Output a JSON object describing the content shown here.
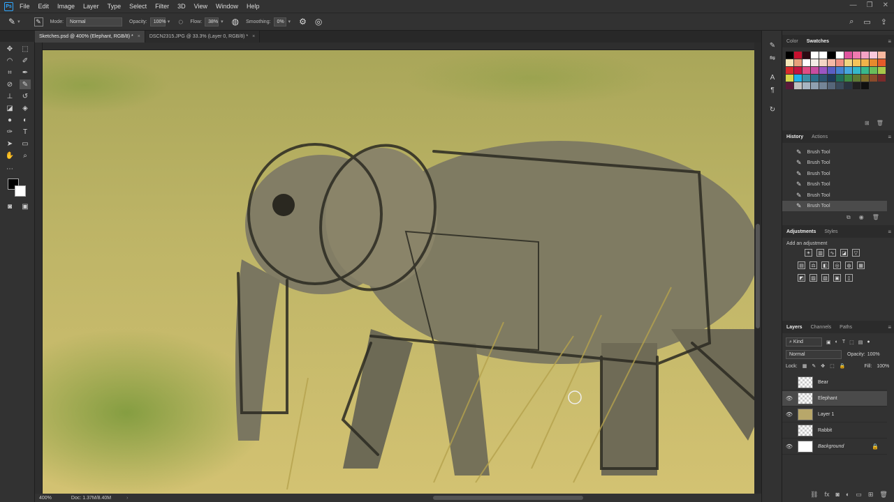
{
  "app": {
    "logo": "Ps"
  },
  "menu": [
    "File",
    "Edit",
    "Image",
    "Layer",
    "Type",
    "Select",
    "Filter",
    "3D",
    "View",
    "Window",
    "Help"
  ],
  "window_controls": [
    "—",
    "❐",
    "✕"
  ],
  "options": {
    "mode_label": "Mode:",
    "mode_value": "Normal",
    "opacity_label": "Opacity:",
    "opacity_value": "100%",
    "flow_label": "Flow:",
    "flow_value": "38%",
    "smoothing_label": "Smoothing:",
    "smoothing_value": "0%"
  },
  "tabs": [
    {
      "label": "Sketches.psd @ 400% (Elephant, RGB/8) *",
      "close": "×"
    },
    {
      "label": "DSCN2315.JPG @ 33.3% (Layer 0, RGB/8) *",
      "close": "×"
    }
  ],
  "status": {
    "zoom": "400%",
    "doc": "Doc: 1.37M/8.40M"
  },
  "swatches_panel": {
    "tabs": [
      "Color",
      "Swatches"
    ]
  },
  "swatch_colors": [
    "#000000",
    "#c8102e",
    "#2b0a13",
    "#ffffff",
    "#ffffff",
    "#000000",
    "#ffffff",
    "#e0559f",
    "#f07ab0",
    "#f4a3c6",
    "#f9c9dc",
    "#f8b9a0",
    "#f5e6b8",
    "#e8a07a",
    "#ffffff",
    "#f3ece6",
    "#f4d6c6",
    "#f5b8a6",
    "#f09082",
    "#f0d580",
    "#f5c45a",
    "#f0b24a",
    "#e88a2d",
    "#e55a2a",
    "#d92b2b",
    "#c3133f",
    "#e04d84",
    "#c84da0",
    "#9a56c3",
    "#5a5ec4",
    "#4582d0",
    "#46a6dd",
    "#35b8c9",
    "#39b88c",
    "#69bd5b",
    "#a8c84a",
    "#d7d64a",
    "#1fb1e6",
    "#3d8fa6",
    "#2d6f8b",
    "#2b5570",
    "#1d3b5a",
    "#206e5a",
    "#3d8a45",
    "#5e7a34",
    "#7e6d2b",
    "#8a4a2a",
    "#7a2a2a",
    "#5a1a3a",
    "#c0c0c0",
    "#a8b5c2",
    "#8fa0b0",
    "#748597",
    "#566679",
    "#3a4a5a",
    "#2a3440",
    "#202020",
    "#101010"
  ],
  "history_panel": {
    "tabs": [
      "History",
      "Actions"
    ],
    "items": [
      "Brush Tool",
      "Brush Tool",
      "Brush Tool",
      "Brush Tool",
      "Brush Tool",
      "Brush Tool"
    ]
  },
  "adjustments_panel": {
    "tabs": [
      "Adjustments",
      "Styles"
    ],
    "add_label": "Add an adjustment"
  },
  "layers_panel": {
    "tabs": [
      "Layers",
      "Channels",
      "Paths"
    ],
    "filter_label": "Kind",
    "blend_mode": "Normal",
    "opacity_label": "Opacity:",
    "opacity_value": "100%",
    "lock_label": "Lock:",
    "fill_label": "Fill:",
    "fill_value": "100%",
    "layers": [
      {
        "name": "Bear",
        "visible": false
      },
      {
        "name": "Elephant",
        "visible": true,
        "selected": true
      },
      {
        "name": "Layer 1",
        "visible": true
      },
      {
        "name": "Rabbit",
        "visible": false
      },
      {
        "name": "Background",
        "visible": true,
        "locked": true
      }
    ]
  }
}
